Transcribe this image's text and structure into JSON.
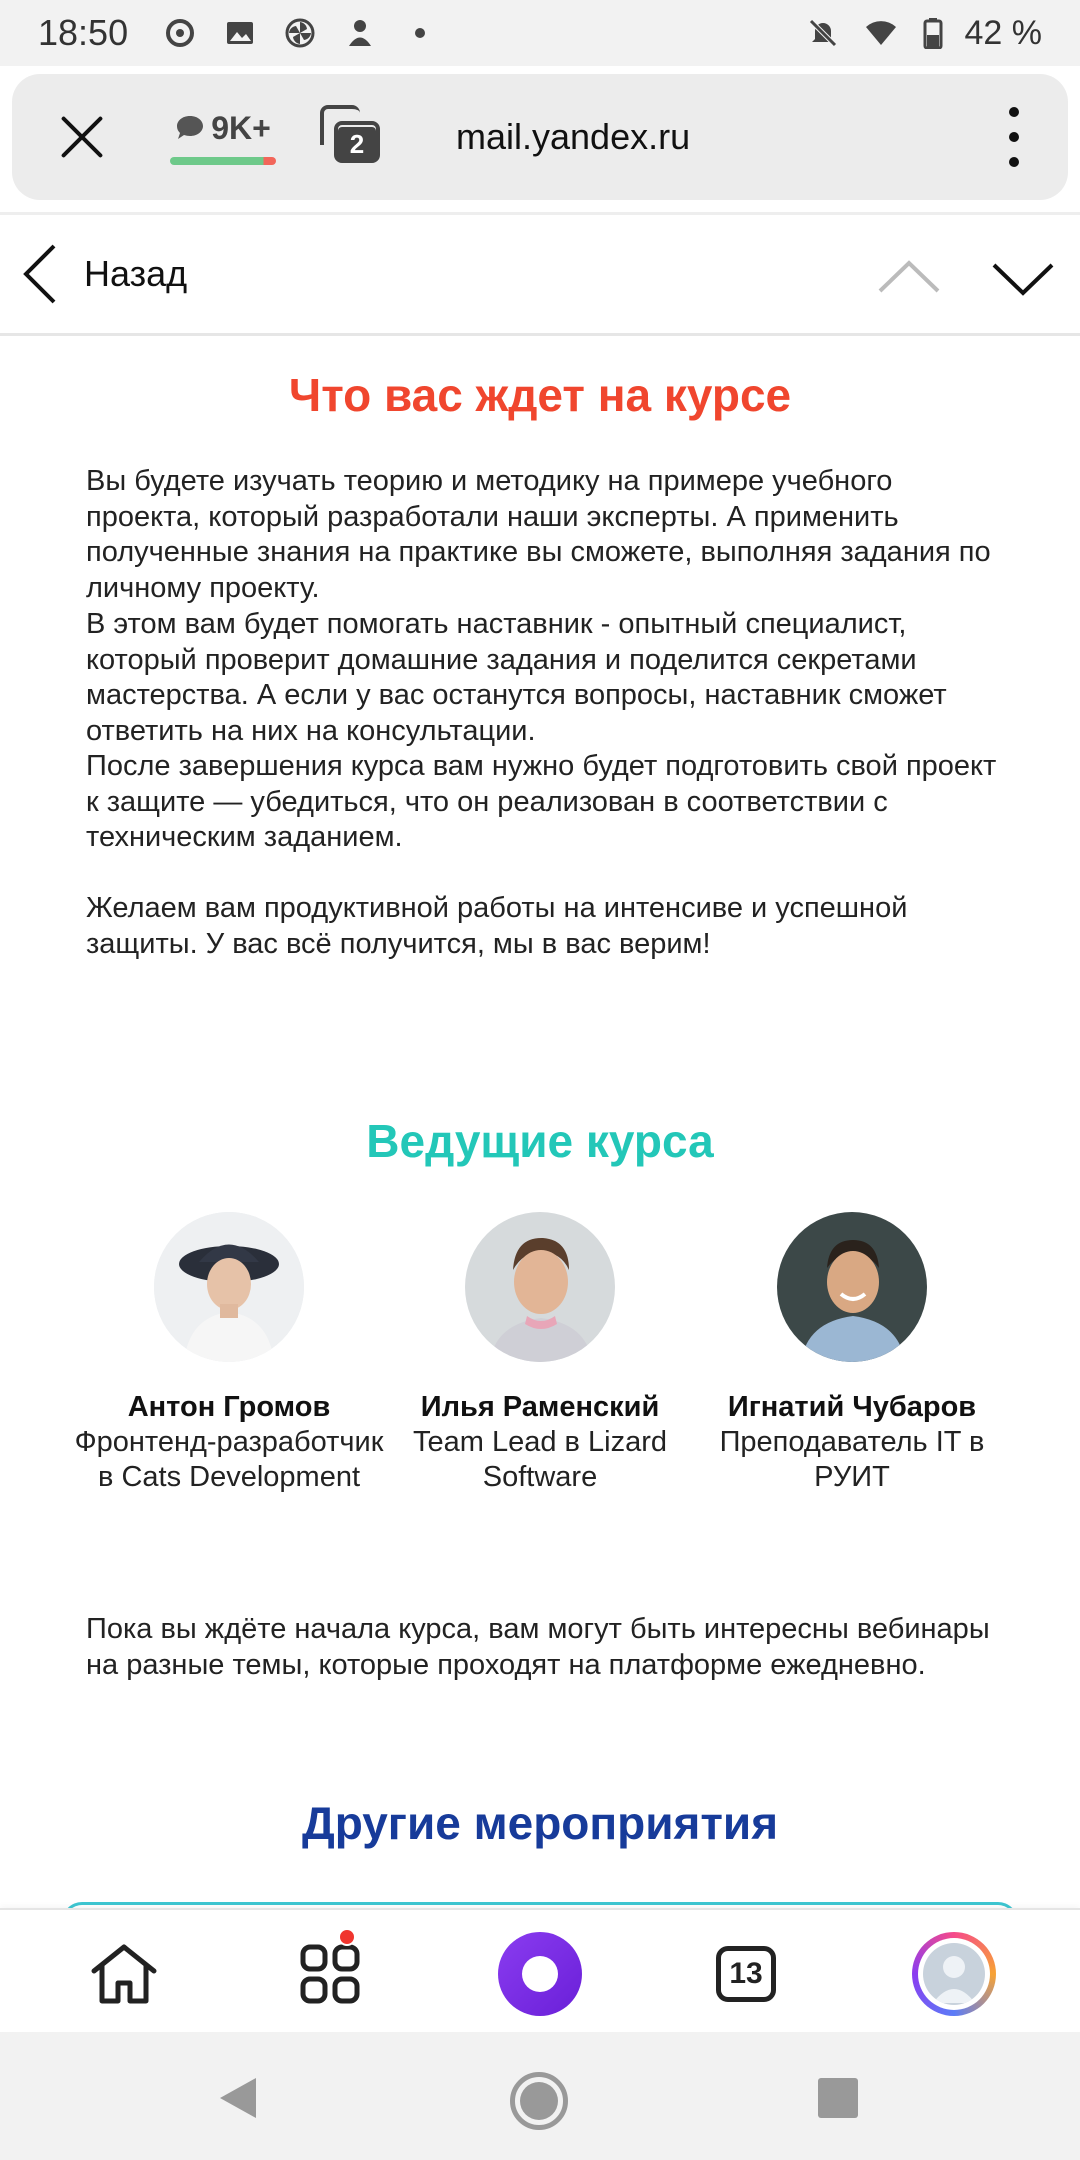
{
  "status_bar": {
    "time": "18:50",
    "battery": "42 %",
    "icons": [
      "media-sync-icon",
      "image-icon",
      "fan-icon",
      "user-icon",
      "dot-icon"
    ],
    "right_icons": [
      "mute-icon",
      "wifi-icon",
      "battery-icon"
    ]
  },
  "browser": {
    "chat_count": "9K+",
    "tabs_count": "2",
    "url": "mail.yandex.ru"
  },
  "nav": {
    "back_label": "Назад"
  },
  "section_intro": {
    "title": "Что вас ждет на курсе",
    "paragraphs": [
      "Вы будете изучать теорию и методику на примере учебного проекта, который разработали наши эксперты. А применить полученные знания на практике вы сможете, выполняя задания по личному проекту.",
      "В этом вам будет помогать наставник - опытный специалист, который проверит домашние задания и поделится секретами мастерства. А если у вас останутся вопросы, наставник сможет ответить на них на консультации.",
      "После завершения курса вам нужно будет подготовить свой проект к защите — убедиться, что он реализован в соответствии с техническим заданием.",
      "Желаем вам продуктивной работы на интенсиве и успешной защиты. У вас всё получится, мы в вас верим!"
    ]
  },
  "section_speakers": {
    "title": "Ведущие курса",
    "speakers": [
      {
        "name": "Антон Громов",
        "role": "Фронтенд-разработчик в Cats Development"
      },
      {
        "name": "Илья Раменский",
        "role": "Team Lead в Lizard Software"
      },
      {
        "name": "Игнатий Чубаров",
        "role": "Преподаватель IT в РУИТ"
      }
    ]
  },
  "webinars_text": "Пока вы ждёте начала курса, вам могут быть интересны вебинары на разные темы, которые проходят на платформе ежедневно.",
  "section_events": {
    "title": "Другие мероприятия"
  },
  "bottom_nav": {
    "tabs_count": "13"
  },
  "colors": {
    "intro_title": "#f0462e",
    "speakers_title": "#23c7b8",
    "events_title": "#173b9a",
    "alice": "#7a2ee6"
  }
}
